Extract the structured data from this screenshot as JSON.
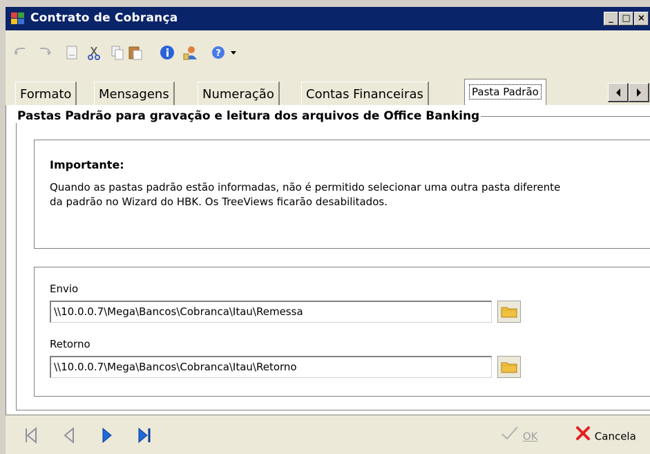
{
  "window": {
    "title": "Contrato de Cobrança",
    "buttons": {
      "minimize": "_",
      "maximize": "□",
      "close": "×"
    }
  },
  "toolbar": {
    "icons": [
      "undo-icon",
      "redo-icon",
      "document-icon",
      "cut-icon",
      "copy-icon",
      "paste-icon",
      "info-icon",
      "user-icon",
      "help-icon",
      "dropdown-arrow-icon"
    ]
  },
  "tabs": [
    {
      "label": "Formato"
    },
    {
      "label": "Mensagens"
    },
    {
      "label": "Numeração"
    },
    {
      "label": "Contas Financeiras"
    },
    {
      "label": "Pasta Padrão",
      "active": true
    }
  ],
  "group": {
    "title": "Pastas Padrão para gravação e leitura dos arquivos de Office Banking"
  },
  "important": {
    "title": "Importante:",
    "text": "Quando as pastas padrão estão informadas, não é permitido selecionar uma outra pasta diferente da padrão no Wizard do HBK. Os TreeViews ficarão desabilitados."
  },
  "fields": {
    "envio": {
      "label": "Envio",
      "value": "\\\\10.0.0.7\\Mega\\Bancos\\Cobranca\\Itau\\Remessa"
    },
    "retorno": {
      "label": "Retorno",
      "value": "\\\\10.0.0.7\\Mega\\Bancos\\Cobranca\\Itau\\Retorno"
    }
  },
  "footer": {
    "ok_label": "OK",
    "cancel_label": "Cancela"
  },
  "colors": {
    "titlebar": "#0a246a",
    "window_bg": "#d4d0c8",
    "panel_bg": "#ffffff",
    "folder_icon": "#f0c040",
    "cancel_icon": "#e02020",
    "nav_active": "#1e6ad6"
  }
}
